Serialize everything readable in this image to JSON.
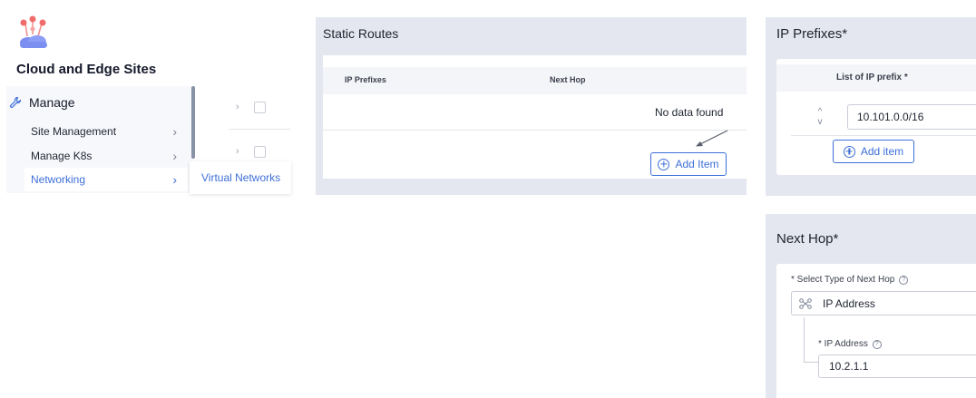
{
  "sidebar": {
    "app_title": "Cloud and Edge Sites",
    "manage_label": "Manage",
    "items": [
      {
        "label": "Site Management",
        "icon": "chevron-right-icon"
      },
      {
        "label": "Manage K8s",
        "icon": "chevron-right-icon"
      },
      {
        "label": "Networking",
        "icon": "chevron-right-icon",
        "active": true
      }
    ],
    "flyout_item": "Virtual Networks"
  },
  "static_routes": {
    "title": "Static Routes",
    "columns": [
      "IP Prefixes",
      "Next Hop"
    ],
    "empty_text": "No data found",
    "add_button": "Add Item"
  },
  "ip_prefixes": {
    "title": "IP Prefixes",
    "required_mark": "*",
    "column": "List of IP prefix *",
    "values": [
      "10.101.0.0/16"
    ],
    "add_button": "Add item"
  },
  "next_hop": {
    "title": "Next Hop",
    "required_mark": "*",
    "type_label": "* Select Type of Next Hop",
    "type_value": "IP Address",
    "ip_label": "* IP Address",
    "ip_value": "10.2.1.1",
    "help_glyph": "?"
  },
  "colors": {
    "accent": "#3d6fd9",
    "panel_bg": "#e4e7f0",
    "sidebar_bg": "#f7f8fb"
  }
}
